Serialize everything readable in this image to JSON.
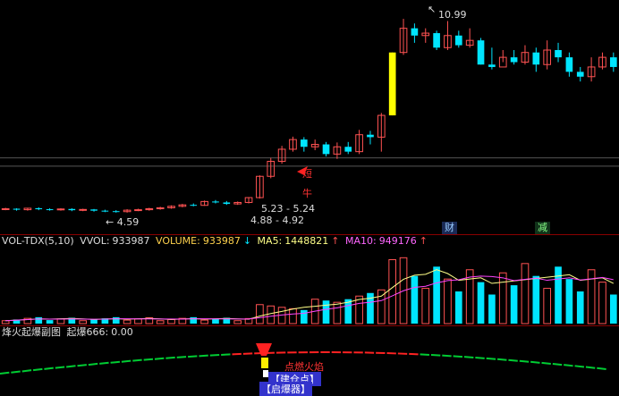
{
  "colors": {
    "up": "#ff5252",
    "down": "#00e5ff",
    "bg": "#000000",
    "grid": "#7a0000",
    "yellow": "#ffff00",
    "ma5": "#ffff88",
    "ma10": "#ff44ff",
    "fire_green": "#00cc33",
    "fire_red": "#ff2222"
  },
  "price": {
    "high_label": "10.99",
    "low_label": "4.59",
    "range_label_1": "5.23 - 5.24",
    "range_label_2": "4.88 - 4.92",
    "marker_text": "短",
    "marker_text_2": "牛",
    "badge_cai": "财",
    "badge_jian": "减",
    "candles": [
      [
        3.12,
        3.14,
        3.18,
        3.08
      ],
      [
        3.14,
        3.1,
        3.16,
        3.06
      ],
      [
        3.1,
        3.16,
        3.18,
        3.06
      ],
      [
        3.16,
        3.12,
        3.2,
        3.08
      ],
      [
        3.12,
        3.1,
        3.16,
        3.06
      ],
      [
        3.1,
        3.13,
        3.16,
        3.06
      ],
      [
        3.13,
        3.08,
        3.16,
        3.04
      ],
      [
        3.08,
        3.11,
        3.14,
        3.04
      ],
      [
        3.11,
        3.06,
        3.13,
        3.02
      ],
      [
        3.06,
        3.04,
        3.1,
        3.0
      ],
      [
        3.04,
        3.02,
        3.08,
        2.98
      ],
      [
        3.02,
        3.08,
        3.12,
        2.98
      ],
      [
        3.08,
        3.1,
        3.14,
        3.04
      ],
      [
        3.1,
        3.14,
        3.18,
        3.06
      ],
      [
        3.14,
        3.18,
        3.22,
        3.1
      ],
      [
        3.18,
        3.24,
        3.28,
        3.14
      ],
      [
        3.24,
        3.3,
        3.34,
        3.2
      ],
      [
        3.3,
        3.28,
        3.36,
        3.24
      ],
      [
        3.28,
        3.44,
        3.48,
        3.26
      ],
      [
        3.44,
        3.4,
        3.5,
        3.36
      ],
      [
        3.4,
        3.34,
        3.46,
        3.3
      ],
      [
        3.34,
        3.4,
        3.44,
        3.3
      ],
      [
        3.4,
        3.6,
        3.62,
        3.36
      ],
      [
        3.6,
        4.48,
        4.52,
        3.56
      ],
      [
        4.48,
        5.1,
        5.24,
        4.4
      ],
      [
        5.1,
        5.6,
        5.74,
        5.0
      ],
      [
        5.6,
        6.0,
        6.12,
        5.5
      ],
      [
        6.0,
        5.7,
        6.1,
        5.5
      ],
      [
        5.7,
        5.8,
        6.0,
        5.56
      ],
      [
        5.8,
        5.4,
        5.9,
        5.3
      ],
      [
        5.4,
        5.7,
        5.88,
        5.2
      ],
      [
        5.7,
        5.5,
        5.9,
        5.4
      ],
      [
        5.5,
        6.2,
        6.4,
        5.4
      ],
      [
        6.2,
        6.1,
        6.36,
        5.8
      ],
      [
        6.1,
        7.0,
        7.1,
        5.5
      ],
      [
        7.0,
        9.6,
        9.6,
        7.0
      ],
      [
        9.6,
        10.6,
        10.99,
        9.5
      ],
      [
        10.6,
        10.3,
        10.8,
        10.0
      ],
      [
        10.3,
        10.4,
        10.6,
        10.0
      ],
      [
        10.4,
        9.8,
        10.5,
        9.7
      ],
      [
        9.8,
        10.3,
        10.9,
        9.7
      ],
      [
        10.3,
        9.9,
        10.5,
        9.8
      ],
      [
        9.9,
        10.1,
        10.6,
        9.8
      ],
      [
        10.1,
        9.1,
        10.2,
        9.1
      ],
      [
        9.1,
        9.0,
        9.8,
        8.9
      ],
      [
        9.0,
        9.4,
        9.7,
        9.2
      ],
      [
        9.4,
        9.2,
        9.7,
        9.1
      ],
      [
        9.2,
        9.6,
        9.9,
        9.1
      ],
      [
        9.6,
        9.1,
        9.8,
        8.8
      ],
      [
        9.1,
        9.7,
        10.1,
        8.9
      ],
      [
        9.7,
        9.4,
        10.0,
        9.2
      ],
      [
        9.4,
        8.8,
        9.6,
        8.6
      ],
      [
        8.8,
        8.6,
        9.0,
        8.4
      ],
      [
        8.6,
        9.0,
        9.4,
        8.4
      ],
      [
        9.0,
        9.4,
        9.6,
        8.9
      ],
      [
        9.4,
        9.0,
        9.6,
        8.8
      ]
    ]
  },
  "volume": {
    "header": {
      "name": "VOL-TDX(5,10)",
      "vvol_label": "VVOL:",
      "vvol_value": "933987",
      "volume_label": "VOLUME:",
      "volume_value": "933987",
      "ma5_label": "MA5:",
      "ma5_value": "1448821",
      "ma10_label": "MA10:",
      "ma10_value": "949176"
    }
  },
  "indicator": {
    "header": {
      "name": "烽火起爆副图",
      "label": "起爆666:",
      "value": "0.00"
    },
    "signal_text_1": "点燃火焰",
    "signal_text_2": "建仓点",
    "signal_text_3": "启爆器"
  }
}
